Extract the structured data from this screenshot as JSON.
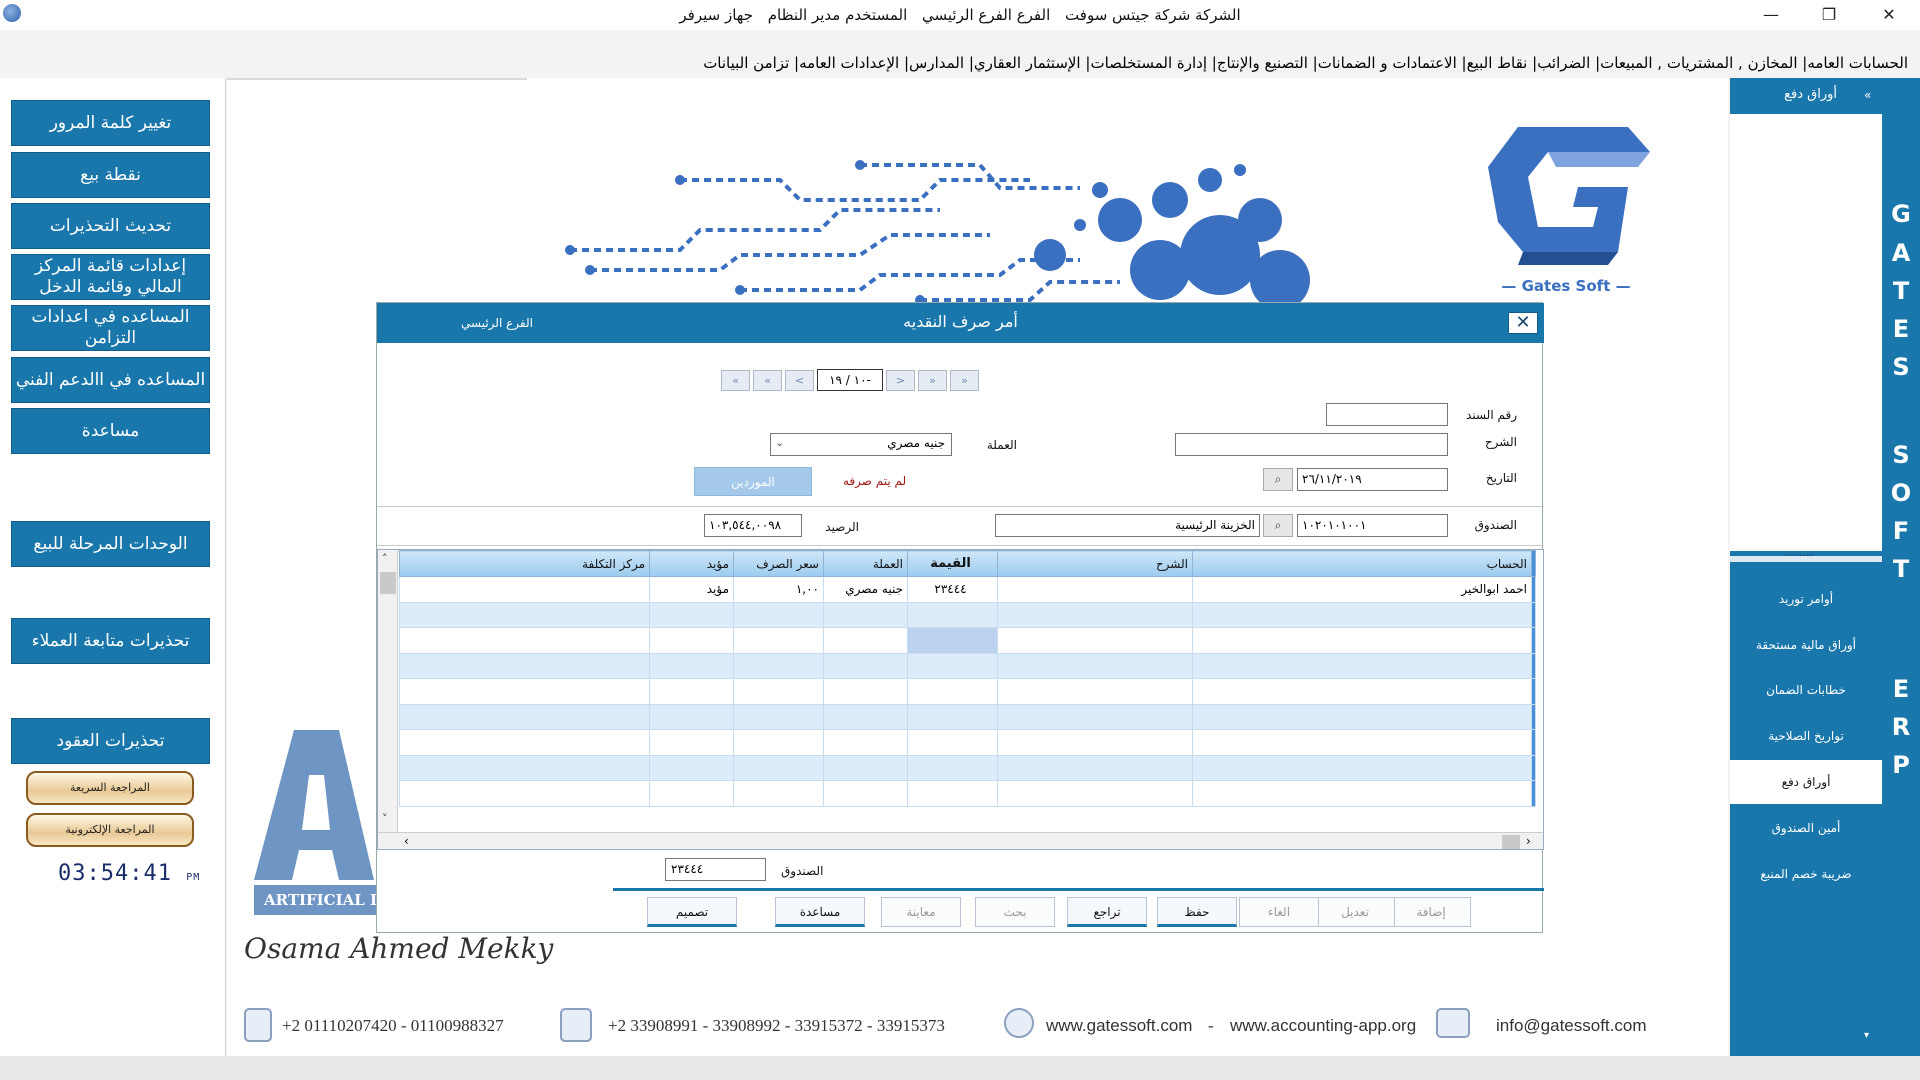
{
  "titlebar": {
    "company": "الشركة شركة جيتس سوفت",
    "branch": "الفرع الفرع الرئيسي",
    "user": "المستخدم مدير النظام",
    "device": "جهاز سيرفر",
    "minimize": "—",
    "maximize": "❐",
    "close": "✕"
  },
  "menu": [
    "الحسابات العامه",
    "المخازن , المشتريات , المبيعات",
    "الضرائب",
    "نقاط البيع",
    "الاعتمادات و الضمانات",
    "التصنيع والإنتاج",
    "إدارة المستخلصات",
    "الإستثمار العقاري",
    "المدارس",
    "الإعدادات العامه",
    "تزامن البيانات"
  ],
  "left_buttons": {
    "change_password": "تغيير كلمة المرور",
    "pos": "نقطة بيع",
    "update_alerts": "تحديث التحذيرات",
    "fin_settings": "إعدادات قائمة المركز المالي وقائمة الدخل",
    "sync_help": "المساعده في اعدادات التزامن",
    "tech_support": "المساعده في االدعم الفني",
    "help": "مساعدة",
    "posted_units": "الوحدات المرحلة للبيع",
    "customer_alerts": "تحذيرات متابعة العملاء",
    "contract_alerts": "تحذيرات العقود",
    "quick_review": "المراجعة السريعة",
    "e_review": "المراجعة الإلكترونية"
  },
  "clock": {
    "time": "03:54:41",
    "ampm": "PM"
  },
  "logo": {
    "text": "Gates Soft"
  },
  "ai_text": "ARTIFICIAL INTELLIGENCE",
  "signature": "Osama Ahmed Mekky",
  "footer": {
    "mobile": "+2 01110207420 - 01100988327",
    "phone": "+2 33908991 - 33908992 - 33915372 - 33915373",
    "web1": "www.gatessoft.com",
    "dash": "-",
    "web2": "www.accounting-app.org",
    "email": "info@gatessoft.com"
  },
  "right_panel": {
    "header": "أوراق دفع",
    "collapse": "«",
    "dots": "........",
    "items": [
      "أوامر توريد",
      "أوراق مالية مستحقة",
      "خطابات الضمان",
      "تواريخ الصلاحية",
      "أوراق دفع",
      "أمين الصندوق",
      "ضريبة خصم المنبع"
    ],
    "active_index": 4,
    "scroll_down": "▾"
  },
  "brand_letters": [
    "G",
    "A",
    "T",
    "E",
    "S",
    "S",
    "O",
    "F",
    "T",
    "E",
    "R",
    "P"
  ],
  "dialog": {
    "title": "أمر صرف النقديه",
    "branch": "الفرع الرئيسي",
    "close": "✕",
    "nav": {
      "first": "«",
      "prev_page": "«",
      "prev": "<",
      "page": "-١٠ / ١٩",
      "next": ">",
      "next_page": "»",
      "last": "»"
    },
    "fields": {
      "doc_no_label": "رقم السند",
      "doc_no_value": "",
      "desc_label": "الشرح",
      "desc_value": "",
      "currency_label": "العملة",
      "currency_value": "جنيه مصري",
      "date_label": "التاريخ",
      "date_value": "٢٦/١١/٢٠١٩",
      "not_paid": "لم يتم صرفه",
      "suppliers_btn": "الموردين",
      "box_label": "الصندوق",
      "box_code": "١٠٢٠١٠١٠٠١",
      "box_name": "الخزينة الرئيسية",
      "balance_label": "الرصيد",
      "balance_value": "١٠٣,٥٤٤,٠٠٩٨"
    },
    "grid": {
      "columns": [
        "الحساب",
        "الشرح",
        "القيمة",
        "العملة",
        "سعر الصرف",
        "مؤيد",
        "مركز التكلفة"
      ],
      "rows": [
        [
          "احمد ابوالخير",
          "",
          "٢٣٤٤٤",
          "جنيه مصري",
          "١,٠٠",
          "مؤيد",
          ""
        ],
        [
          "",
          "",
          "",
          "",
          "",
          "",
          ""
        ],
        [
          "",
          "",
          "",
          "",
          "",
          "",
          ""
        ],
        [
          "",
          "",
          "",
          "",
          "",
          "",
          ""
        ],
        [
          "",
          "",
          "",
          "",
          "",
          "",
          ""
        ],
        [
          "",
          "",
          "",
          "",
          "",
          "",
          ""
        ],
        [
          "",
          "",
          "",
          "",
          "",
          "",
          ""
        ],
        [
          "",
          "",
          "",
          "",
          "",
          "",
          ""
        ],
        [
          "",
          "",
          "",
          "",
          "",
          "",
          ""
        ]
      ]
    },
    "total_label": "الصندوق",
    "total_value": "٢٣٤٤٤",
    "actions": {
      "add": "إضافة",
      "edit": "تعديل",
      "cancel": "الغاء",
      "save": "حفظ",
      "undo": "تراجع",
      "search": "بحث",
      "preview": "معاينة",
      "help": "مساعدة",
      "design": "تصميم"
    }
  },
  "colors": {
    "primary": "#1a77ac",
    "grid_header": "#9ccbef",
    "grid_alt_row": "#dcecfb",
    "not_paid": "#a01818"
  }
}
